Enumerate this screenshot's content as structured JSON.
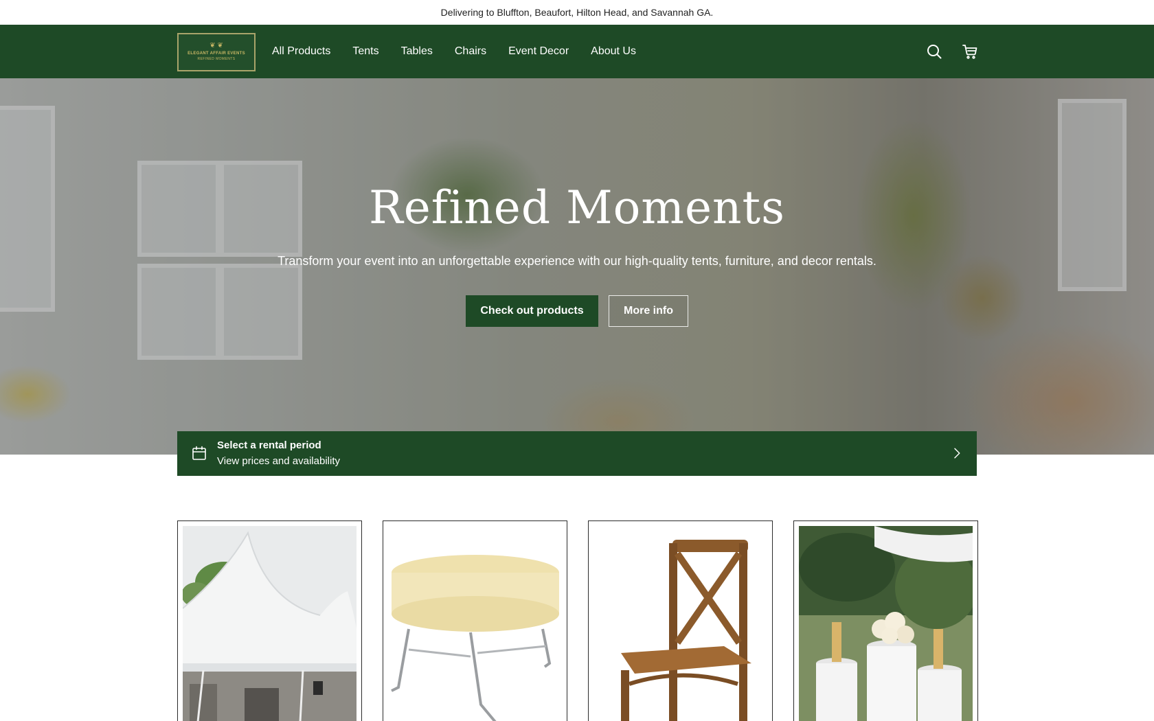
{
  "announcement": "Delivering to Bluffton, Beaufort, Hilton Head, and Savannah GA.",
  "logo": {
    "line1": "ELEGANT AFFAIR EVENTS",
    "line2": "REFINED MOMENTS"
  },
  "nav": {
    "links": [
      "All Products",
      "Tents",
      "Tables",
      "Chairs",
      "Event Decor",
      "About Us"
    ],
    "icons": [
      "search-icon",
      "cart-icon"
    ]
  },
  "hero": {
    "title": "Refined Moments",
    "subtitle": "Transform your event into an unforgettable experience with our high-quality tents, furniture, and decor rentals.",
    "primary_button": "Check out products",
    "secondary_button": "More info"
  },
  "rental": {
    "title": "Select a rental period",
    "subtitle": "View prices and availability",
    "icon": "calendar-icon",
    "arrow_icon": "chevron-right-icon"
  },
  "categories": [
    {
      "image": "tent-image"
    },
    {
      "image": "table-image"
    },
    {
      "image": "chair-image"
    },
    {
      "image": "event-decor-image"
    }
  ],
  "colors": {
    "brand_green": "#1e4a26",
    "logo_gold": "#c9b765",
    "text_dark": "#1f1f1f"
  }
}
